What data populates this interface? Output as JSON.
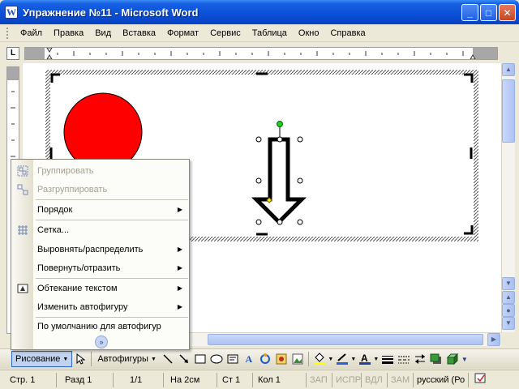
{
  "window": {
    "title": "Упражнение №11 - Microsoft Word",
    "app_icon_letter": "W",
    "minimize": "_",
    "maximize": "□",
    "close": "✕"
  },
  "menu": [
    "Файл",
    "Правка",
    "Вид",
    "Вставка",
    "Формат",
    "Сервис",
    "Таблица",
    "Окно",
    "Справка"
  ],
  "ruler": {
    "tab_selector": "L"
  },
  "context_menu": {
    "items": [
      {
        "label": "Группировать",
        "disabled": true,
        "icon": "group-icon"
      },
      {
        "label": "Разгруппировать",
        "disabled": true,
        "icon": "ungroup-icon"
      },
      {
        "label": "Порядок",
        "submenu": true
      },
      {
        "label": "Сетка...",
        "icon": "grid-icon"
      },
      {
        "label": "Выровнять/распределить",
        "submenu": true
      },
      {
        "label": "Повернуть/отразить",
        "submenu": true
      },
      {
        "label": "Обтекание текстом",
        "submenu": true,
        "icon": "text-wrap-icon"
      },
      {
        "label": "Изменить автофигуру",
        "submenu": true
      },
      {
        "label": "По умолчанию для автофигур"
      }
    ],
    "more": "»"
  },
  "drawing_toolbar": {
    "drawing": "Рисование",
    "autoshapes": "Автофигуры"
  },
  "status": {
    "page": "Стр. 1",
    "section": "Разд 1",
    "pages": "1/1",
    "at": "На 2см",
    "line": "Ст 1",
    "col": "Кол 1",
    "rec": "ЗАП",
    "trk": "ИСПР",
    "ext": "ВДЛ",
    "ovr": "ЗАМ",
    "lang": "русский (Ро"
  },
  "colors": {
    "circle": "#ff0000",
    "title_bar": "#0a4fd6"
  }
}
